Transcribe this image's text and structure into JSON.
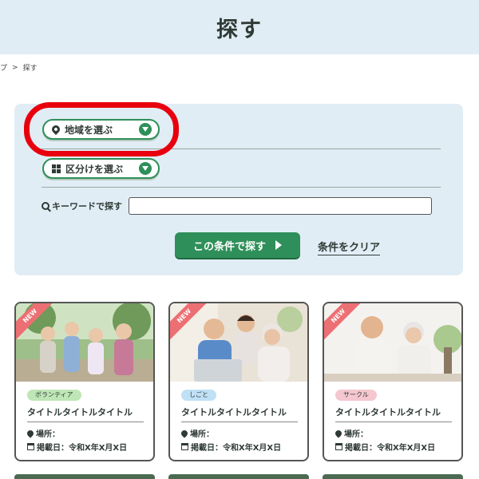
{
  "header": {
    "title": "探す"
  },
  "breadcrumb": {
    "items": [
      "プ",
      ">",
      "探す"
    ]
  },
  "search": {
    "region_select_label": "地域を選ぶ",
    "category_select_label": "区分けを選ぶ",
    "keyword_label": "キーワードで探す",
    "keyword_value": "",
    "keyword_placeholder": "",
    "search_button_label": "この条件で探す",
    "clear_link_label": "条件をクリア"
  },
  "cards": [
    {
      "badge": "NEW",
      "tag": "ボランティア",
      "tag_color": "#bfe6b6",
      "title": "タイトルタイトルタイトル",
      "place_label": "場所：",
      "date_label": "掲載日：令和X年X月X日"
    },
    {
      "badge": "NEW",
      "tag": "しごと",
      "tag_color": "#bfe0f5",
      "title": "タイトルタイトルタイトル",
      "place_label": "場所：",
      "date_label": "掲載日：令和X年X月X日"
    },
    {
      "badge": "NEW",
      "tag": "サークル",
      "tag_color": "#f5c7cf",
      "title": "タイトルタイトルタイトル",
      "place_label": "場所：",
      "date_label": "掲載日：令和X年X月X日"
    }
  ],
  "colors": {
    "accent_green": "#2f8f5a",
    "panel_bg": "#e1edf5",
    "highlight_red": "#e8000f",
    "new_ribbon": "#ec6f73"
  },
  "icons": {
    "region": "map-pin-icon",
    "category": "grid-icon",
    "dropdown": "chevron-down-icon",
    "keyword": "search-icon",
    "submit": "play-arrow-icon",
    "place": "map-pin-icon",
    "date": "calendar-icon"
  }
}
